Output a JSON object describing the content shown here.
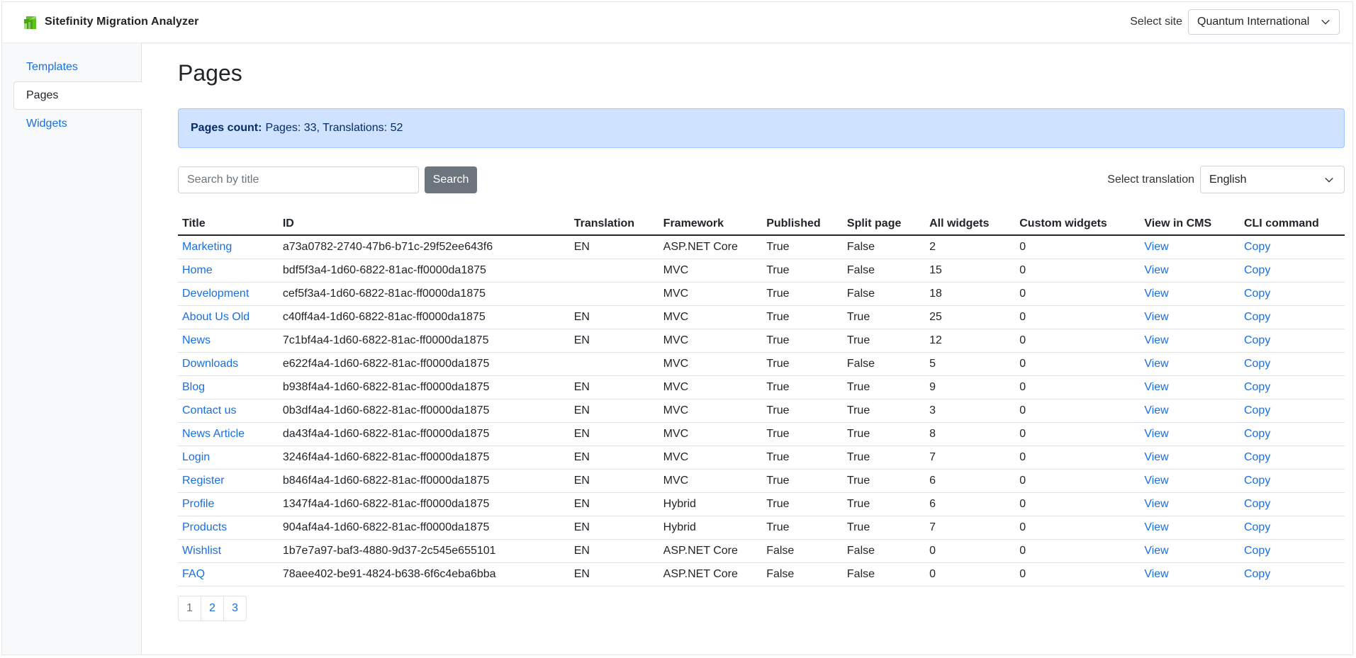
{
  "header": {
    "app_title": "Sitefinity Migration Analyzer",
    "site_label": "Select site",
    "site_value": "Quantum International",
    "brand_color": "#5fc11c"
  },
  "sidebar": {
    "items": [
      {
        "label": "Templates",
        "active": false
      },
      {
        "label": "Pages",
        "active": true
      },
      {
        "label": "Widgets",
        "active": false
      }
    ]
  },
  "main": {
    "title": "Pages",
    "alert": {
      "label": "Pages count:",
      "text": "Pages: 33, Translations: 52"
    },
    "search": {
      "placeholder": "Search by title",
      "value": "",
      "button": "Search"
    },
    "translation": {
      "label": "Select translation",
      "value": "English"
    }
  },
  "table": {
    "headers": [
      "Title",
      "ID",
      "Translation",
      "Framework",
      "Published",
      "Split page",
      "All widgets",
      "Custom widgets",
      "View in CMS",
      "CLI command"
    ],
    "rows": [
      [
        "Marketing",
        "a73a0782-2740-47b6-b71c-29f52ee643f6",
        "EN",
        "ASP.NET Core",
        "True",
        "False",
        "2",
        "0",
        "View",
        "Copy"
      ],
      [
        "Home",
        "bdf5f3a4-1d60-6822-81ac-ff0000da1875",
        "",
        "MVC",
        "True",
        "False",
        "15",
        "0",
        "View",
        "Copy"
      ],
      [
        "Development",
        "cef5f3a4-1d60-6822-81ac-ff0000da1875",
        "",
        "MVC",
        "True",
        "False",
        "18",
        "0",
        "View",
        "Copy"
      ],
      [
        "About Us Old",
        "c40ff4a4-1d60-6822-81ac-ff0000da1875",
        "EN",
        "MVC",
        "True",
        "True",
        "25",
        "0",
        "View",
        "Copy"
      ],
      [
        "News",
        "7c1bf4a4-1d60-6822-81ac-ff0000da1875",
        "EN",
        "MVC",
        "True",
        "True",
        "12",
        "0",
        "View",
        "Copy"
      ],
      [
        "Downloads",
        "e622f4a4-1d60-6822-81ac-ff0000da1875",
        "",
        "MVC",
        "True",
        "False",
        "5",
        "0",
        "View",
        "Copy"
      ],
      [
        "Blog",
        "b938f4a4-1d60-6822-81ac-ff0000da1875",
        "EN",
        "MVC",
        "True",
        "True",
        "9",
        "0",
        "View",
        "Copy"
      ],
      [
        "Contact us",
        "0b3df4a4-1d60-6822-81ac-ff0000da1875",
        "EN",
        "MVC",
        "True",
        "True",
        "3",
        "0",
        "View",
        "Copy"
      ],
      [
        "News Article",
        "da43f4a4-1d60-6822-81ac-ff0000da1875",
        "EN",
        "MVC",
        "True",
        "True",
        "8",
        "0",
        "View",
        "Copy"
      ],
      [
        "Login",
        "3246f4a4-1d60-6822-81ac-ff0000da1875",
        "EN",
        "MVC",
        "True",
        "True",
        "7",
        "0",
        "View",
        "Copy"
      ],
      [
        "Register",
        "b846f4a4-1d60-6822-81ac-ff0000da1875",
        "EN",
        "MVC",
        "True",
        "True",
        "6",
        "0",
        "View",
        "Copy"
      ],
      [
        "Profile",
        "1347f4a4-1d60-6822-81ac-ff0000da1875",
        "EN",
        "Hybrid",
        "True",
        "True",
        "6",
        "0",
        "View",
        "Copy"
      ],
      [
        "Products",
        "904af4a4-1d60-6822-81ac-ff0000da1875",
        "EN",
        "Hybrid",
        "True",
        "True",
        "7",
        "0",
        "View",
        "Copy"
      ],
      [
        "Wishlist",
        "1b7e7a97-baf3-4880-9d37-2c545e655101",
        "EN",
        "ASP.NET Core",
        "False",
        "False",
        "0",
        "0",
        "View",
        "Copy"
      ],
      [
        "FAQ",
        "78aee402-be91-4824-b638-6f6c4eba6bba",
        "EN",
        "ASP.NET Core",
        "False",
        "False",
        "0",
        "0",
        "View",
        "Copy"
      ]
    ]
  },
  "pagination": {
    "pages": [
      "1",
      "2",
      "3"
    ],
    "current": "1"
  }
}
